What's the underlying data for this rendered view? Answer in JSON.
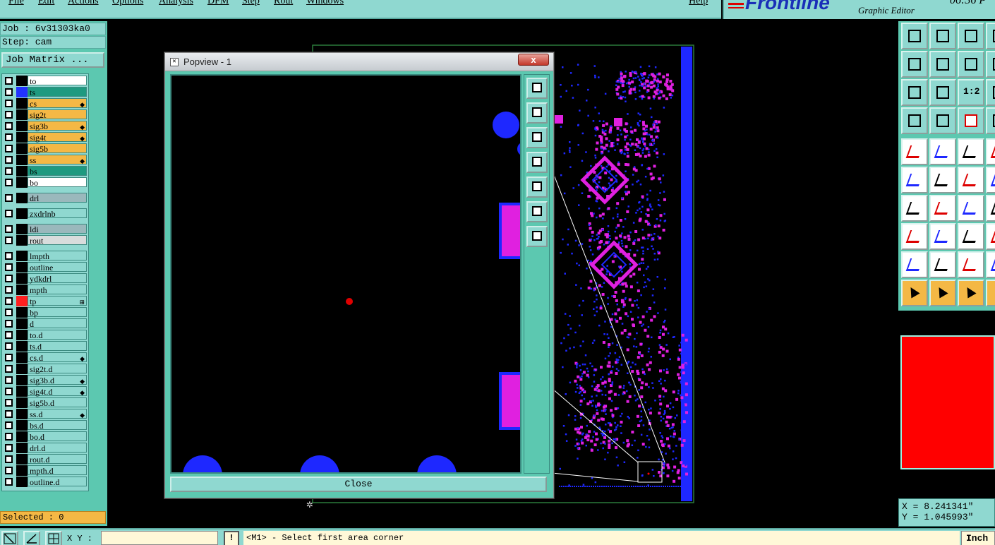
{
  "menubar": {
    "items": [
      "File",
      "Edit",
      "Actions",
      "Options",
      "Analysis",
      "DFM",
      "Step",
      "Rout",
      "Windows"
    ],
    "help": "Help"
  },
  "brand": {
    "logo": "Frontline",
    "subtitle": "Graphic Editor",
    "time": "06:36 P"
  },
  "left": {
    "job": "Job : 6v31303ka0",
    "step": "Step: cam",
    "job_matrix": "Job Matrix ...",
    "layers": [
      {
        "name": "to",
        "color": "#ffffff",
        "swatch": "#000000",
        "mark": ""
      },
      {
        "name": "ts",
        "color": "#1e9a80",
        "swatch": "#2233ff",
        "mark": ""
      },
      {
        "name": "cs",
        "color": "#f4b845",
        "swatch": "#000000",
        "mark": "◆"
      },
      {
        "name": "sig2t",
        "color": "#f4b845",
        "swatch": "#000000",
        "mark": ""
      },
      {
        "name": "sig3b",
        "color": "#f4b845",
        "swatch": "#000000",
        "mark": "◆"
      },
      {
        "name": "sig4t",
        "color": "#f4b845",
        "swatch": "#000000",
        "mark": "◆"
      },
      {
        "name": "sig5b",
        "color": "#f4b845",
        "swatch": "#000000",
        "mark": ""
      },
      {
        "name": "ss",
        "color": "#f4b845",
        "swatch": "#000000",
        "mark": "◆"
      },
      {
        "name": "bs",
        "color": "#1e9a80",
        "swatch": "#000000",
        "mark": ""
      },
      {
        "name": "bo",
        "color": "#ffffff",
        "swatch": "#000000",
        "mark": ""
      },
      {
        "name": "drl",
        "color": "#9ab8bc",
        "swatch": "#000000",
        "mark": ""
      },
      {
        "name": "zxdrlnb",
        "color": "#8fd8d0",
        "swatch": "#000000",
        "mark": ""
      },
      {
        "name": "ldi",
        "color": "#9ab8bc",
        "swatch": "#000000",
        "mark": ""
      },
      {
        "name": "rout",
        "color": "#d8dcdc",
        "swatch": "#000000",
        "mark": ""
      },
      {
        "name": "lmpth",
        "color": "#8fd8d0",
        "swatch": "#000000",
        "mark": ""
      },
      {
        "name": "outline",
        "color": "#8fd8d0",
        "swatch": "#000000",
        "mark": ""
      },
      {
        "name": "ydkdrl",
        "color": "#8fd8d0",
        "swatch": "#000000",
        "mark": ""
      },
      {
        "name": "mpth",
        "color": "#8fd8d0",
        "swatch": "#000000",
        "mark": ""
      },
      {
        "name": "tp",
        "color": "#8fd8d0",
        "swatch": "#ff2020",
        "mark": "⊞"
      },
      {
        "name": "bp",
        "color": "#8fd8d0",
        "swatch": "#000000",
        "mark": ""
      },
      {
        "name": "d",
        "color": "#8fd8d0",
        "swatch": "#000000",
        "mark": ""
      },
      {
        "name": "to.d",
        "color": "#8fd8d0",
        "swatch": "#000000",
        "mark": ""
      },
      {
        "name": "ts.d",
        "color": "#8fd8d0",
        "swatch": "#000000",
        "mark": ""
      },
      {
        "name": "cs.d",
        "color": "#8fd8d0",
        "swatch": "#000000",
        "mark": "◆"
      },
      {
        "name": "sig2t.d",
        "color": "#8fd8d0",
        "swatch": "#000000",
        "mark": ""
      },
      {
        "name": "sig3b.d",
        "color": "#8fd8d0",
        "swatch": "#000000",
        "mark": "◆"
      },
      {
        "name": "sig4t.d",
        "color": "#8fd8d0",
        "swatch": "#000000",
        "mark": "◆"
      },
      {
        "name": "sig5b.d",
        "color": "#8fd8d0",
        "swatch": "#000000",
        "mark": ""
      },
      {
        "name": "ss.d",
        "color": "#8fd8d0",
        "swatch": "#000000",
        "mark": "◆"
      },
      {
        "name": "bs.d",
        "color": "#8fd8d0",
        "swatch": "#000000",
        "mark": ""
      },
      {
        "name": "bo.d",
        "color": "#8fd8d0",
        "swatch": "#000000",
        "mark": ""
      },
      {
        "name": "drl.d",
        "color": "#8fd8d0",
        "swatch": "#000000",
        "mark": ""
      },
      {
        "name": "rout.d",
        "color": "#8fd8d0",
        "swatch": "#000000",
        "mark": ""
      },
      {
        "name": "mpth.d",
        "color": "#8fd8d0",
        "swatch": "#000000",
        "mark": ""
      },
      {
        "name": "outline.d",
        "color": "#8fd8d0",
        "swatch": "#000000",
        "mark": ""
      }
    ],
    "selected": "Selected : 0"
  },
  "popview": {
    "title": "Popview - 1",
    "close_x": "x",
    "close_button": "Close",
    "tools": [
      "zoom-fit-icon",
      "pan-up-icon",
      "pan-down-icon",
      "pan-left-icon",
      "pan-right-icon",
      "zoom-out-icon",
      "zoom-in-icon"
    ]
  },
  "right": {
    "tools": [
      "home-icon",
      "refresh-icon",
      "scale-1to2-icon",
      "grid-icon",
      "layers-icon",
      "ruler-icon",
      "pointer-icon"
    ],
    "scale_label": "1:2",
    "coord_x": "X = 8.241341\"",
    "coord_y": "Y = 1.045993\""
  },
  "status": {
    "xy_label": "X Y :",
    "warn": "!",
    "prompt": "<M1> - Select first area corner",
    "units": "Inch"
  },
  "colors": {
    "panel": "#8fd8d0",
    "panel_dark": "#5cc8b0",
    "pad_blue": "#1e28ff",
    "pad_magenta": "#e020e0",
    "selected_bg": "#f4b845"
  }
}
